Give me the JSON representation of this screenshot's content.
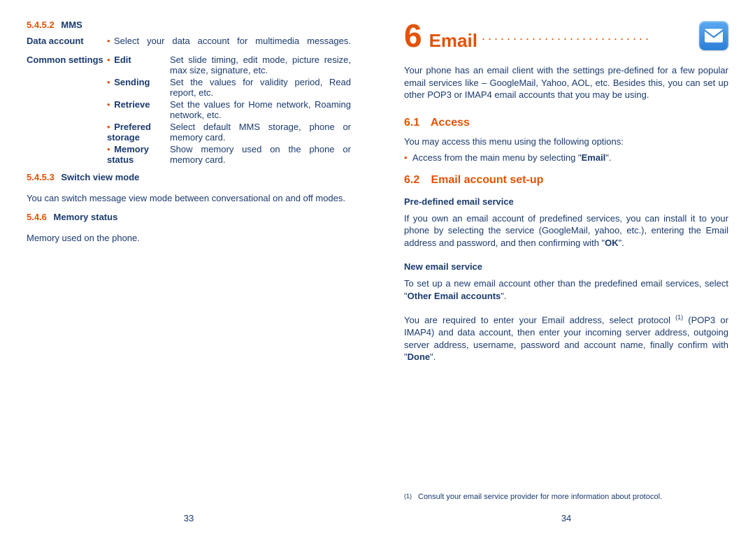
{
  "left": {
    "sec1": {
      "num": "5.4.5.2",
      "title": "MMS"
    },
    "data_account": {
      "label": "Data account",
      "desc": "Select your data account for multimedia messages."
    },
    "common_label": "Common settings",
    "items": [
      {
        "label": "Edit",
        "desc": "Set slide timing, edit mode, picture resize, max size, signature, etc."
      },
      {
        "label": "Sending",
        "desc": "Set the values for validity period, Read report, etc."
      },
      {
        "label": "Retrieve",
        "desc": "Set the values for Home network, Roaming network, etc."
      },
      {
        "label": "Prefered storage",
        "desc": "Select default MMS storage, phone or memory card."
      },
      {
        "label": "Memory status",
        "desc": "Show memory used on the phone or memory card."
      }
    ],
    "sec2": {
      "num": "5.4.5.3",
      "title": "Switch view mode"
    },
    "sec2_body": "You can switch message view mode between conversational on and off modes.",
    "sec3": {
      "num": "5.4.6",
      "title": "Memory status"
    },
    "sec3_body": "Memory used on the phone.",
    "page_num": "33"
  },
  "right": {
    "chapter_num": "6",
    "chapter_title": "Email",
    "dots": "...........................",
    "intro": "Your phone has an email client with the settings pre-defined for a few popular email services like – GoogleMail, Yahoo, AOL, etc. Besides this, you can set up other POP3 or IMAP4 email accounts that you may be using.",
    "s61": {
      "num": "6.1",
      "title": "Access"
    },
    "s61_body": "You may access this menu using the following options:",
    "s61_bullet_pre": "Access from the main menu by selecting \"",
    "s61_bullet_bold": "Email",
    "s61_bullet_post": "\".",
    "s62": {
      "num": "6.2",
      "title": "Email account set-up"
    },
    "pre_h": "Pre-defined email service",
    "pre_body_a": "If you own an email account of predefined services, you can install it to your phone by selecting the service (GoogleMail, yahoo, etc.), entering the Email address and password, and then confirming with \"",
    "pre_body_bold": "OK",
    "pre_body_b": "\".",
    "new_h": "New email service",
    "new_body_a": "To set up a new email account other than the predefined email services, select \"",
    "new_body_bold": "Other Email accounts",
    "new_body_b": "\".",
    "new_body2_a": "You are required to enter your Email address, select protocol ",
    "new_body2_sup": "(1)",
    "new_body2_b": " (POP3 or IMAP4) and data account, then enter your incoming server address, outgoing server address, username, password and account name, finally confirm with \"",
    "new_body2_bold": "Done",
    "new_body2_c": "\".",
    "footnote_mark": "(1)",
    "footnote": "Consult your email service provider for more information about protocol.",
    "page_num": "34"
  }
}
